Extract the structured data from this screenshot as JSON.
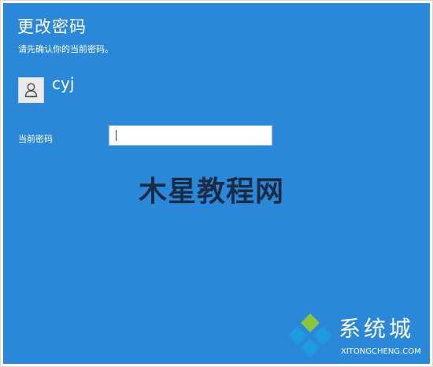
{
  "dialog": {
    "title": "更改密码",
    "subtitle": "请先确认你的当前密码。"
  },
  "user": {
    "avatar_icon": "user-icon",
    "name": "cyj"
  },
  "form": {
    "current_password_label": "当前密码",
    "current_password_value": "",
    "current_password_placeholder": ""
  },
  "watermark": {
    "text": "木星教程网"
  },
  "logo": {
    "icon": "diamond-logo-icon",
    "text_cn": "系统城",
    "text_en": "XITONGCHENG.COM"
  },
  "colors": {
    "panel_background": "#2b88d8",
    "text": "#ffffff",
    "watermark": "#1a2b45",
    "logo_green": "#8ac53f",
    "logo_blue": "#1e9be0"
  }
}
